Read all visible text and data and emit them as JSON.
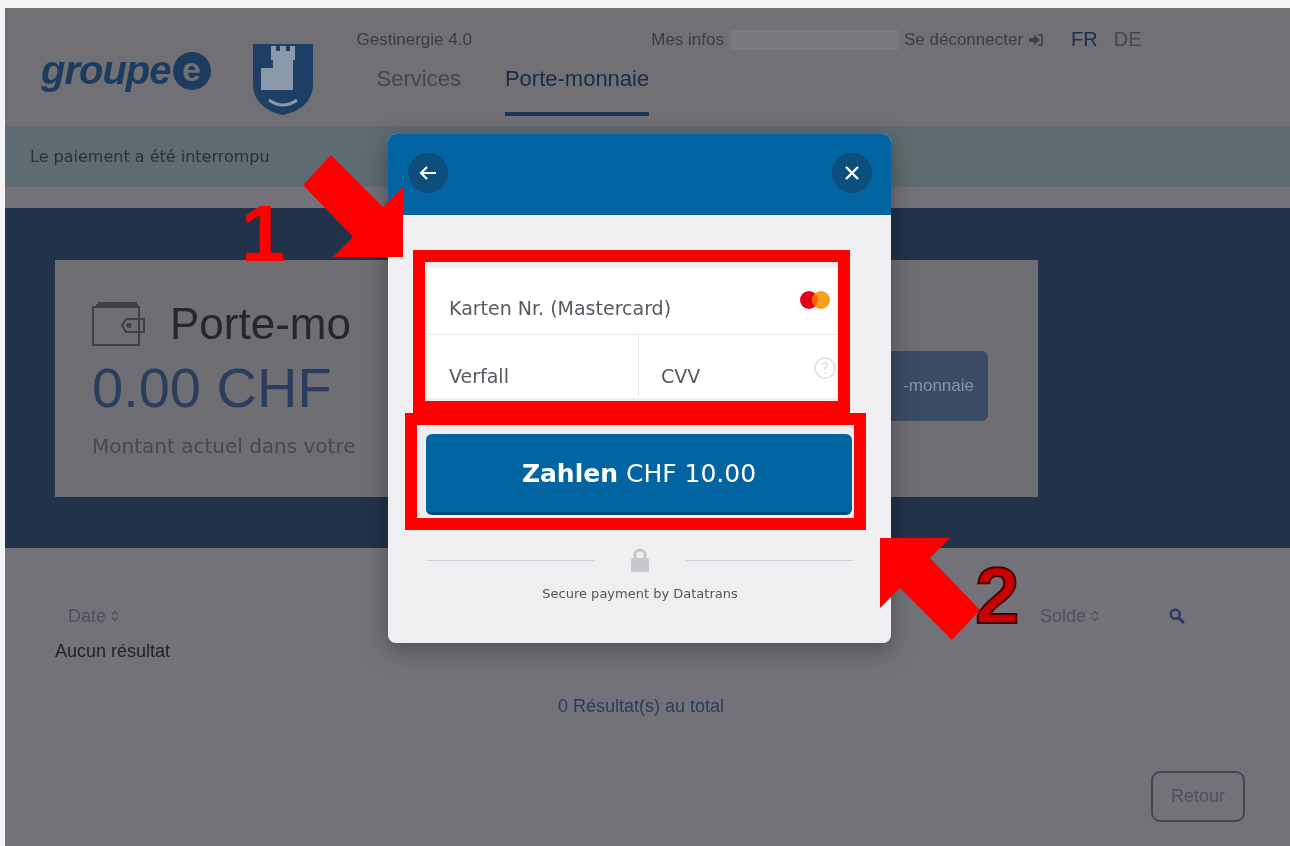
{
  "header": {
    "logo_text": "groupe",
    "logo_mark": "e",
    "app_name": "Gestinergie 4.0",
    "nav": [
      {
        "label": "Services",
        "selected": false
      },
      {
        "label": "Porte-monnaie",
        "selected": true
      }
    ],
    "user_link": "Mes infos",
    "logout": "Se déconnecter",
    "languages": [
      {
        "label": "FR",
        "selected": true
      },
      {
        "label": "DE",
        "selected": false
      }
    ]
  },
  "alert": {
    "text": "Le paiement a été interrompu"
  },
  "wallet_card": {
    "title": "Porte-mo",
    "amount": "0.00 CHF",
    "caption": "Montant actuel dans votre",
    "button": "-monnaie"
  },
  "table": {
    "columns": [
      {
        "label": "Date",
        "sortable": true
      },
      {
        "label": "Solde",
        "sortable": true
      }
    ],
    "empty_text": "Aucun résultat",
    "total": "0 Résultat(s) au total"
  },
  "back_button": "Retour",
  "payment_dialog": {
    "card_number": {
      "placeholder": "Karten Nr. (Mastercard)"
    },
    "expiry": {
      "placeholder": "Verfall"
    },
    "cvv": {
      "placeholder": "CVV"
    },
    "pay_button": {
      "action": "Zahlen",
      "amount": "CHF 10.00"
    },
    "footer": "Secure payment by Datatrans"
  },
  "annotations": [
    {
      "label": "1"
    },
    {
      "label": "2"
    }
  ]
}
